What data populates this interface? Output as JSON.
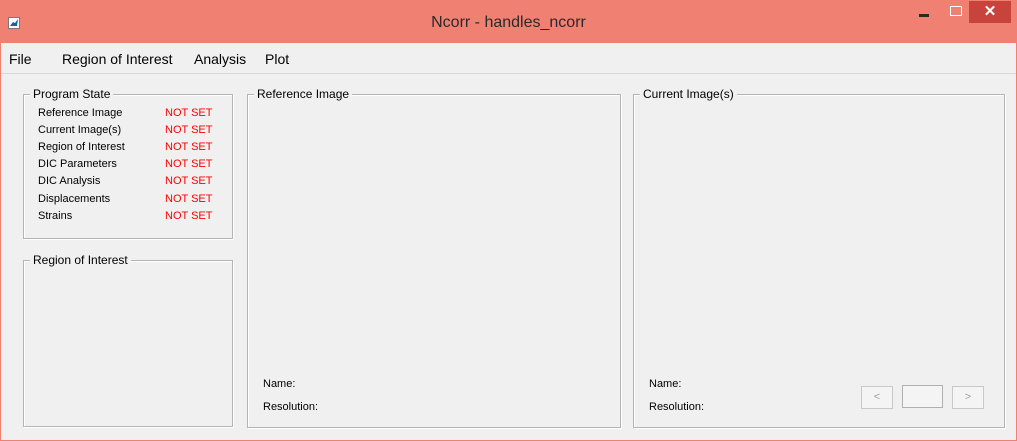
{
  "window": {
    "title": "Ncorr - handles_ncorr",
    "close_glyph": "✕",
    "accent_color": "#f08072",
    "close_color": "#c7433b"
  },
  "menu": [
    "File",
    "Region of Interest",
    "Analysis",
    "Plot"
  ],
  "program_state": {
    "title": "Program State",
    "items": [
      {
        "label": "Reference Image",
        "status": "NOT SET"
      },
      {
        "label": "Current Image(s)",
        "status": "NOT SET"
      },
      {
        "label": "Region of Interest",
        "status": "NOT SET"
      },
      {
        "label": "DIC Parameters",
        "status": "NOT SET"
      },
      {
        "label": "DIC Analysis",
        "status": "NOT SET"
      },
      {
        "label": "Displacements",
        "status": "NOT SET"
      },
      {
        "label": "Strains",
        "status": "NOT SET"
      }
    ],
    "status_color": "#ff0000"
  },
  "roi_panel": {
    "title": "Region of Interest"
  },
  "reference_panel": {
    "title": "Reference Image",
    "name_label": "Name:",
    "resolution_label": "Resolution:"
  },
  "current_panel": {
    "title": "Current Image(s)",
    "name_label": "Name:",
    "resolution_label": "Resolution:",
    "prev_label": "<",
    "next_label": ">",
    "index_value": ""
  }
}
